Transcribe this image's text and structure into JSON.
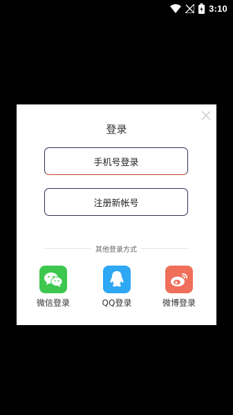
{
  "status_bar": {
    "time": "3:10",
    "icons": [
      "wifi-icon",
      "signal-icon",
      "battery-charging-icon"
    ]
  },
  "dialog": {
    "title": "登录",
    "close_icon": "close-icon",
    "phone_login_label": "手机号登录",
    "register_label": "注册新帐号",
    "divider_text": "其他登录方式",
    "social": [
      {
        "label": "微信登录",
        "icon": "wechat-icon",
        "color": "#3ec74f"
      },
      {
        "label": "QQ登录",
        "icon": "qq-icon",
        "color": "#2ea7f4"
      },
      {
        "label": "微博登录",
        "icon": "weibo-icon",
        "color": "#ef6f5b"
      }
    ]
  },
  "colors": {
    "background": "#000000",
    "dialog": "#ffffff",
    "button_border": "#2b2f55"
  }
}
